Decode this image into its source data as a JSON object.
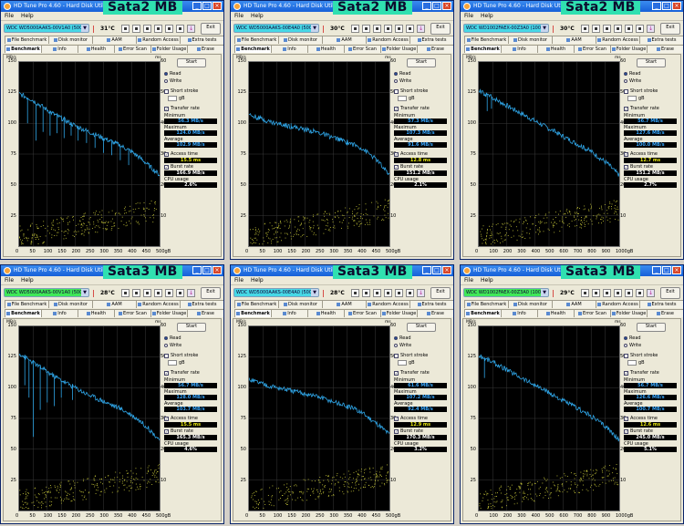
{
  "windows": [
    {
      "title": "HD Tune Pro 4.60 - Hard Disk Utility",
      "overlay": "Sata2 MB",
      "drive": "WDC WD5000AAKS-00V1A0 (500 gB)",
      "drive_color": "cyan",
      "temperature": "31°C",
      "x_labels": [
        "0",
        "50",
        "100",
        "150",
        "200",
        "250",
        "300",
        "350",
        "400",
        "450",
        "500gB"
      ],
      "x_max": 500,
      "minimum": "56.3 MB/s",
      "maximum": "124.0 MB/s",
      "average": "102.9 MB/s",
      "access_time": "15.5 ms",
      "burst_rate": "166.9 MB/s",
      "cpu_usage": "2.6%",
      "curve": [
        [
          0,
          124
        ],
        [
          40,
          120
        ],
        [
          80,
          114
        ],
        [
          120,
          108
        ],
        [
          160,
          103
        ],
        [
          200,
          98
        ],
        [
          240,
          94
        ],
        [
          280,
          90
        ],
        [
          320,
          86
        ],
        [
          360,
          82
        ],
        [
          400,
          77
        ],
        [
          430,
          72
        ],
        [
          460,
          66
        ],
        [
          480,
          62
        ],
        [
          500,
          58
        ]
      ],
      "dips": [
        [
          30,
          100
        ],
        [
          60,
          86
        ],
        [
          85,
          93
        ],
        [
          110,
          90
        ],
        [
          135,
          92
        ],
        [
          160,
          88
        ],
        [
          185,
          90
        ],
        [
          210,
          86
        ],
        [
          240,
          84
        ],
        [
          270,
          80
        ],
        [
          300,
          76
        ],
        [
          330,
          74
        ],
        [
          360,
          70
        ],
        [
          390,
          66
        ]
      ]
    },
    {
      "title": "HD Tune Pro 4.60 - Hard Disk Utility",
      "overlay": "Sata2 MB",
      "drive": "WDC WD5000AAKS-00E4A0 (500 gB)",
      "drive_color": "cyan",
      "temperature": "30°C",
      "x_labels": [
        "0",
        "50",
        "100",
        "150",
        "200",
        "250",
        "300",
        "350",
        "400",
        "450",
        "500gB"
      ],
      "x_max": 500,
      "minimum": "57.3 MB/s",
      "maximum": "107.3 MB/s",
      "average": "91.6 MB/s",
      "access_time": "12.8 ms",
      "burst_rate": "151.2 MB/s",
      "cpu_usage": "2.1%",
      "curve": [
        [
          0,
          107
        ],
        [
          40,
          104
        ],
        [
          80,
          101
        ],
        [
          120,
          99
        ],
        [
          160,
          97
        ],
        [
          200,
          95
        ],
        [
          240,
          93
        ],
        [
          280,
          90
        ],
        [
          320,
          87
        ],
        [
          360,
          84
        ],
        [
          400,
          80
        ],
        [
          430,
          75
        ],
        [
          460,
          69
        ],
        [
          480,
          63
        ],
        [
          500,
          58
        ]
      ],
      "dips": [
        [
          150,
          100
        ],
        [
          250,
          93
        ],
        [
          350,
          82
        ]
      ]
    },
    {
      "title": "HD Tune Pro 4.60 - Hard Disk Utility",
      "overlay": "Sata2 MB",
      "drive": "WDC WD1002FAEX-00Z3A0 (1000 gB)",
      "drive_color": "cyan",
      "temperature": "30°C",
      "x_labels": [
        "0",
        "100",
        "200",
        "300",
        "400",
        "500",
        "600",
        "700",
        "800",
        "900",
        "1000gB"
      ],
      "x_max": 1000,
      "minimum": "56.7 MB/s",
      "maximum": "127.6 MB/s",
      "average": "100.0 MB/s",
      "access_time": "12.7 ms",
      "burst_rate": "151.2 MB/s",
      "cpu_usage": "2.7%",
      "curve": [
        [
          0,
          126
        ],
        [
          80,
          122
        ],
        [
          160,
          117
        ],
        [
          240,
          112
        ],
        [
          320,
          107
        ],
        [
          400,
          102
        ],
        [
          480,
          97
        ],
        [
          560,
          92
        ],
        [
          640,
          87
        ],
        [
          720,
          82
        ],
        [
          800,
          77
        ],
        [
          860,
          72
        ],
        [
          920,
          67
        ],
        [
          960,
          62
        ],
        [
          1000,
          58
        ]
      ],
      "dips": [
        [
          60,
          110
        ],
        [
          90,
          112
        ]
      ]
    },
    {
      "title": "HD Tune Pro 4.60 - Hard Disk Utility",
      "overlay": "Sata3 MB",
      "drive": "WDC WD5000AAKS-00V1A0 (500 gB)",
      "drive_color": "green",
      "temperature": "28°C",
      "x_labels": [
        "0",
        "50",
        "100",
        "150",
        "200",
        "250",
        "300",
        "350",
        "400",
        "450",
        "500gB"
      ],
      "x_max": 500,
      "minimum": "56.7 MB/s",
      "maximum": "128.0 MB/s",
      "average": "103.7 MB/s",
      "access_time": "15.5 ms",
      "burst_rate": "165.3 MB/s",
      "cpu_usage": "4.6%",
      "curve": [
        [
          0,
          128
        ],
        [
          40,
          122
        ],
        [
          80,
          116
        ],
        [
          120,
          110
        ],
        [
          160,
          105
        ],
        [
          200,
          100
        ],
        [
          240,
          95
        ],
        [
          280,
          91
        ],
        [
          320,
          87
        ],
        [
          360,
          83
        ],
        [
          400,
          78
        ],
        [
          430,
          73
        ],
        [
          460,
          67
        ],
        [
          480,
          62
        ],
        [
          500,
          58
        ]
      ],
      "dips": [
        [
          20,
          102
        ],
        [
          35,
          92
        ],
        [
          50,
          60
        ],
        [
          75,
          82
        ],
        [
          100,
          88
        ],
        [
          125,
          85
        ],
        [
          150,
          92
        ],
        [
          190,
          90
        ]
      ]
    },
    {
      "title": "HD Tune Pro 4.60 - Hard Disk Utility",
      "overlay": "Sata3 MB",
      "drive": "WDC WD5000AAKS-00E4A0 (500 gB)",
      "drive_color": "cyan",
      "temperature": "28°C",
      "x_labels": [
        "0",
        "50",
        "100",
        "150",
        "200",
        "250",
        "300",
        "350",
        "400",
        "450",
        "500gB"
      ],
      "x_max": 500,
      "minimum": "61.6 MB/s",
      "maximum": "107.2 MB/s",
      "average": "92.4 MB/s",
      "access_time": "12.9 ms",
      "burst_rate": "170.3 MB/s",
      "cpu_usage": "3.2%",
      "curve": [
        [
          0,
          107
        ],
        [
          40,
          104
        ],
        [
          80,
          101
        ],
        [
          120,
          99
        ],
        [
          160,
          97
        ],
        [
          200,
          95
        ],
        [
          240,
          93
        ],
        [
          280,
          90
        ],
        [
          320,
          87
        ],
        [
          360,
          84
        ],
        [
          400,
          80
        ],
        [
          430,
          75
        ],
        [
          460,
          70
        ],
        [
          480,
          66
        ],
        [
          500,
          62
        ]
      ],
      "dips": []
    },
    {
      "title": "HD Tune Pro 4.60 - Hard Disk Utility",
      "overlay": "Sata3 MB",
      "drive": "WDC WD1002FAEX-00Z3A0 (1000 gB)",
      "drive_color": "green",
      "temperature": "29°C",
      "x_labels": [
        "0",
        "100",
        "200",
        "300",
        "400",
        "500",
        "600",
        "700",
        "800",
        "900",
        "1000gB"
      ],
      "x_max": 1000,
      "minimum": "56.7 MB/s",
      "maximum": "126.6 MB/s",
      "average": "100.7 MB/s",
      "access_time": "12.6 ms",
      "burst_rate": "245.0 MB/s",
      "cpu_usage": "5.1%",
      "curve": [
        [
          0,
          126
        ],
        [
          80,
          122
        ],
        [
          160,
          117
        ],
        [
          240,
          112
        ],
        [
          320,
          107
        ],
        [
          400,
          102
        ],
        [
          480,
          97
        ],
        [
          560,
          92
        ],
        [
          640,
          87
        ],
        [
          720,
          82
        ],
        [
          800,
          77
        ],
        [
          860,
          72
        ],
        [
          920,
          67
        ],
        [
          960,
          62
        ],
        [
          1000,
          57
        ]
      ],
      "dips": [
        [
          40,
          108
        ]
      ]
    }
  ],
  "ui": {
    "menu_file": "File",
    "menu_help": "Help",
    "exit": "Exit",
    "tabs_top": [
      "File Benchmark",
      "Disk monitor",
      "AAM",
      "Random Access",
      "Extra tests"
    ],
    "tabs_bottom": [
      "Benchmark",
      "Info",
      "Health",
      "Error Scan",
      "Folder Usage",
      "Erase"
    ],
    "start": "Start",
    "read": "Read",
    "write": "Write",
    "short_stroke": "Short stroke",
    "gb": "gB",
    "transfer_rate": "Transfer rate",
    "minimum": "Minimum",
    "maximum": "Maximum",
    "average": "Average",
    "access_time": "Access time",
    "burst_rate": "Burst rate",
    "cpu_usage": "CPU usage",
    "y_left_unit": "MB/s",
    "y_right_unit": "ms",
    "y_left_ticks": [
      "150",
      "125",
      "100",
      "75",
      "50",
      "25"
    ],
    "y_right_ticks": [
      "60",
      "50",
      "40",
      "30",
      "20",
      "10"
    ]
  },
  "colors": {
    "transfer_curve": "#2fa6e8",
    "access_points": "#c8c83a",
    "graph_bg": "#000000",
    "grid": "#3a3a3a",
    "overlay_bg": "#30e0b0"
  }
}
